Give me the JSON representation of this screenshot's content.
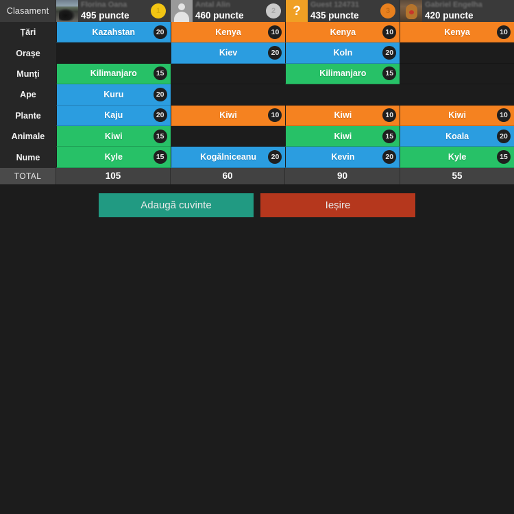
{
  "header": {
    "corner_label": "Clasament",
    "points_suffix": "puncte"
  },
  "players": [
    {
      "name": "Florina Oana",
      "points": "495 puncte",
      "rank": "1",
      "rank_class": "rank-1",
      "avatar": "photo-avatar",
      "avatar_class": "photo1"
    },
    {
      "name": "Antal Alin",
      "points": "460 puncte",
      "rank": "2",
      "rank_class": "rank-2",
      "avatar": "silhouette-avatar",
      "avatar_class": "silhouette"
    },
    {
      "name": "Guest 124731",
      "points": "435 puncte",
      "rank": "3",
      "rank_class": "rank-3",
      "avatar": "question-mark-avatar",
      "avatar_class": "question",
      "question_glyph": "?"
    },
    {
      "name": "Gabriel Engelha",
      "points": "420 puncte",
      "rank": "",
      "rank_class": "rank-none",
      "avatar": "teddy-bear-photo-avatar",
      "avatar_class": "photo4"
    }
  ],
  "categories": [
    "Țări",
    "Orașe",
    "Munți",
    "Ape",
    "Plante",
    "Animale",
    "Nume"
  ],
  "total_label": "TOTAL",
  "totals": [
    "105",
    "60",
    "90",
    "55"
  ],
  "answers": [
    [
      {
        "text": "Kazahstan",
        "points": "20",
        "color": "blue"
      },
      {
        "text": "",
        "points": "",
        "color": "empty"
      },
      {
        "text": "Kilimanjaro",
        "points": "15",
        "color": "green"
      },
      {
        "text": "Kuru",
        "points": "20",
        "color": "blue"
      },
      {
        "text": "Kaju",
        "points": "20",
        "color": "blue"
      },
      {
        "text": "Kiwi",
        "points": "15",
        "color": "green"
      },
      {
        "text": "Kyle",
        "points": "15",
        "color": "green"
      }
    ],
    [
      {
        "text": "Kenya",
        "points": "10",
        "color": "orange"
      },
      {
        "text": "Kiev",
        "points": "20",
        "color": "blue"
      },
      {
        "text": "",
        "points": "",
        "color": "empty"
      },
      {
        "text": "",
        "points": "",
        "color": "empty"
      },
      {
        "text": "Kiwi",
        "points": "10",
        "color": "orange"
      },
      {
        "text": "",
        "points": "",
        "color": "empty"
      },
      {
        "text": "Kogălniceanu",
        "points": "20",
        "color": "blue"
      }
    ],
    [
      {
        "text": "Kenya",
        "points": "10",
        "color": "orange"
      },
      {
        "text": "Koln",
        "points": "20",
        "color": "blue"
      },
      {
        "text": "Kilimanjaro",
        "points": "15",
        "color": "green"
      },
      {
        "text": "",
        "points": "",
        "color": "empty"
      },
      {
        "text": "Kiwi",
        "points": "10",
        "color": "orange"
      },
      {
        "text": "Kiwi",
        "points": "15",
        "color": "green"
      },
      {
        "text": "Kevin",
        "points": "20",
        "color": "blue"
      }
    ],
    [
      {
        "text": "Kenya",
        "points": "10",
        "color": "orange"
      },
      {
        "text": "",
        "points": "",
        "color": "empty"
      },
      {
        "text": "",
        "points": "",
        "color": "empty"
      },
      {
        "text": "",
        "points": "",
        "color": "empty"
      },
      {
        "text": "Kiwi",
        "points": "10",
        "color": "orange"
      },
      {
        "text": "Koala",
        "points": "20",
        "color": "blue"
      },
      {
        "text": "Kyle",
        "points": "15",
        "color": "green"
      }
    ]
  ],
  "buttons": {
    "add_words": "Adaugă cuvinte",
    "exit": "Ieșire"
  },
  "colors": {
    "blue": "#2b9de0",
    "green": "#27c167",
    "orange": "#f58220",
    "empty": "#1c1c1c",
    "add_button": "#219a82",
    "exit_button": "#b5371d",
    "gold": "#f2c513",
    "silver": "#c9c9c9",
    "bronze": "#e8801e"
  }
}
